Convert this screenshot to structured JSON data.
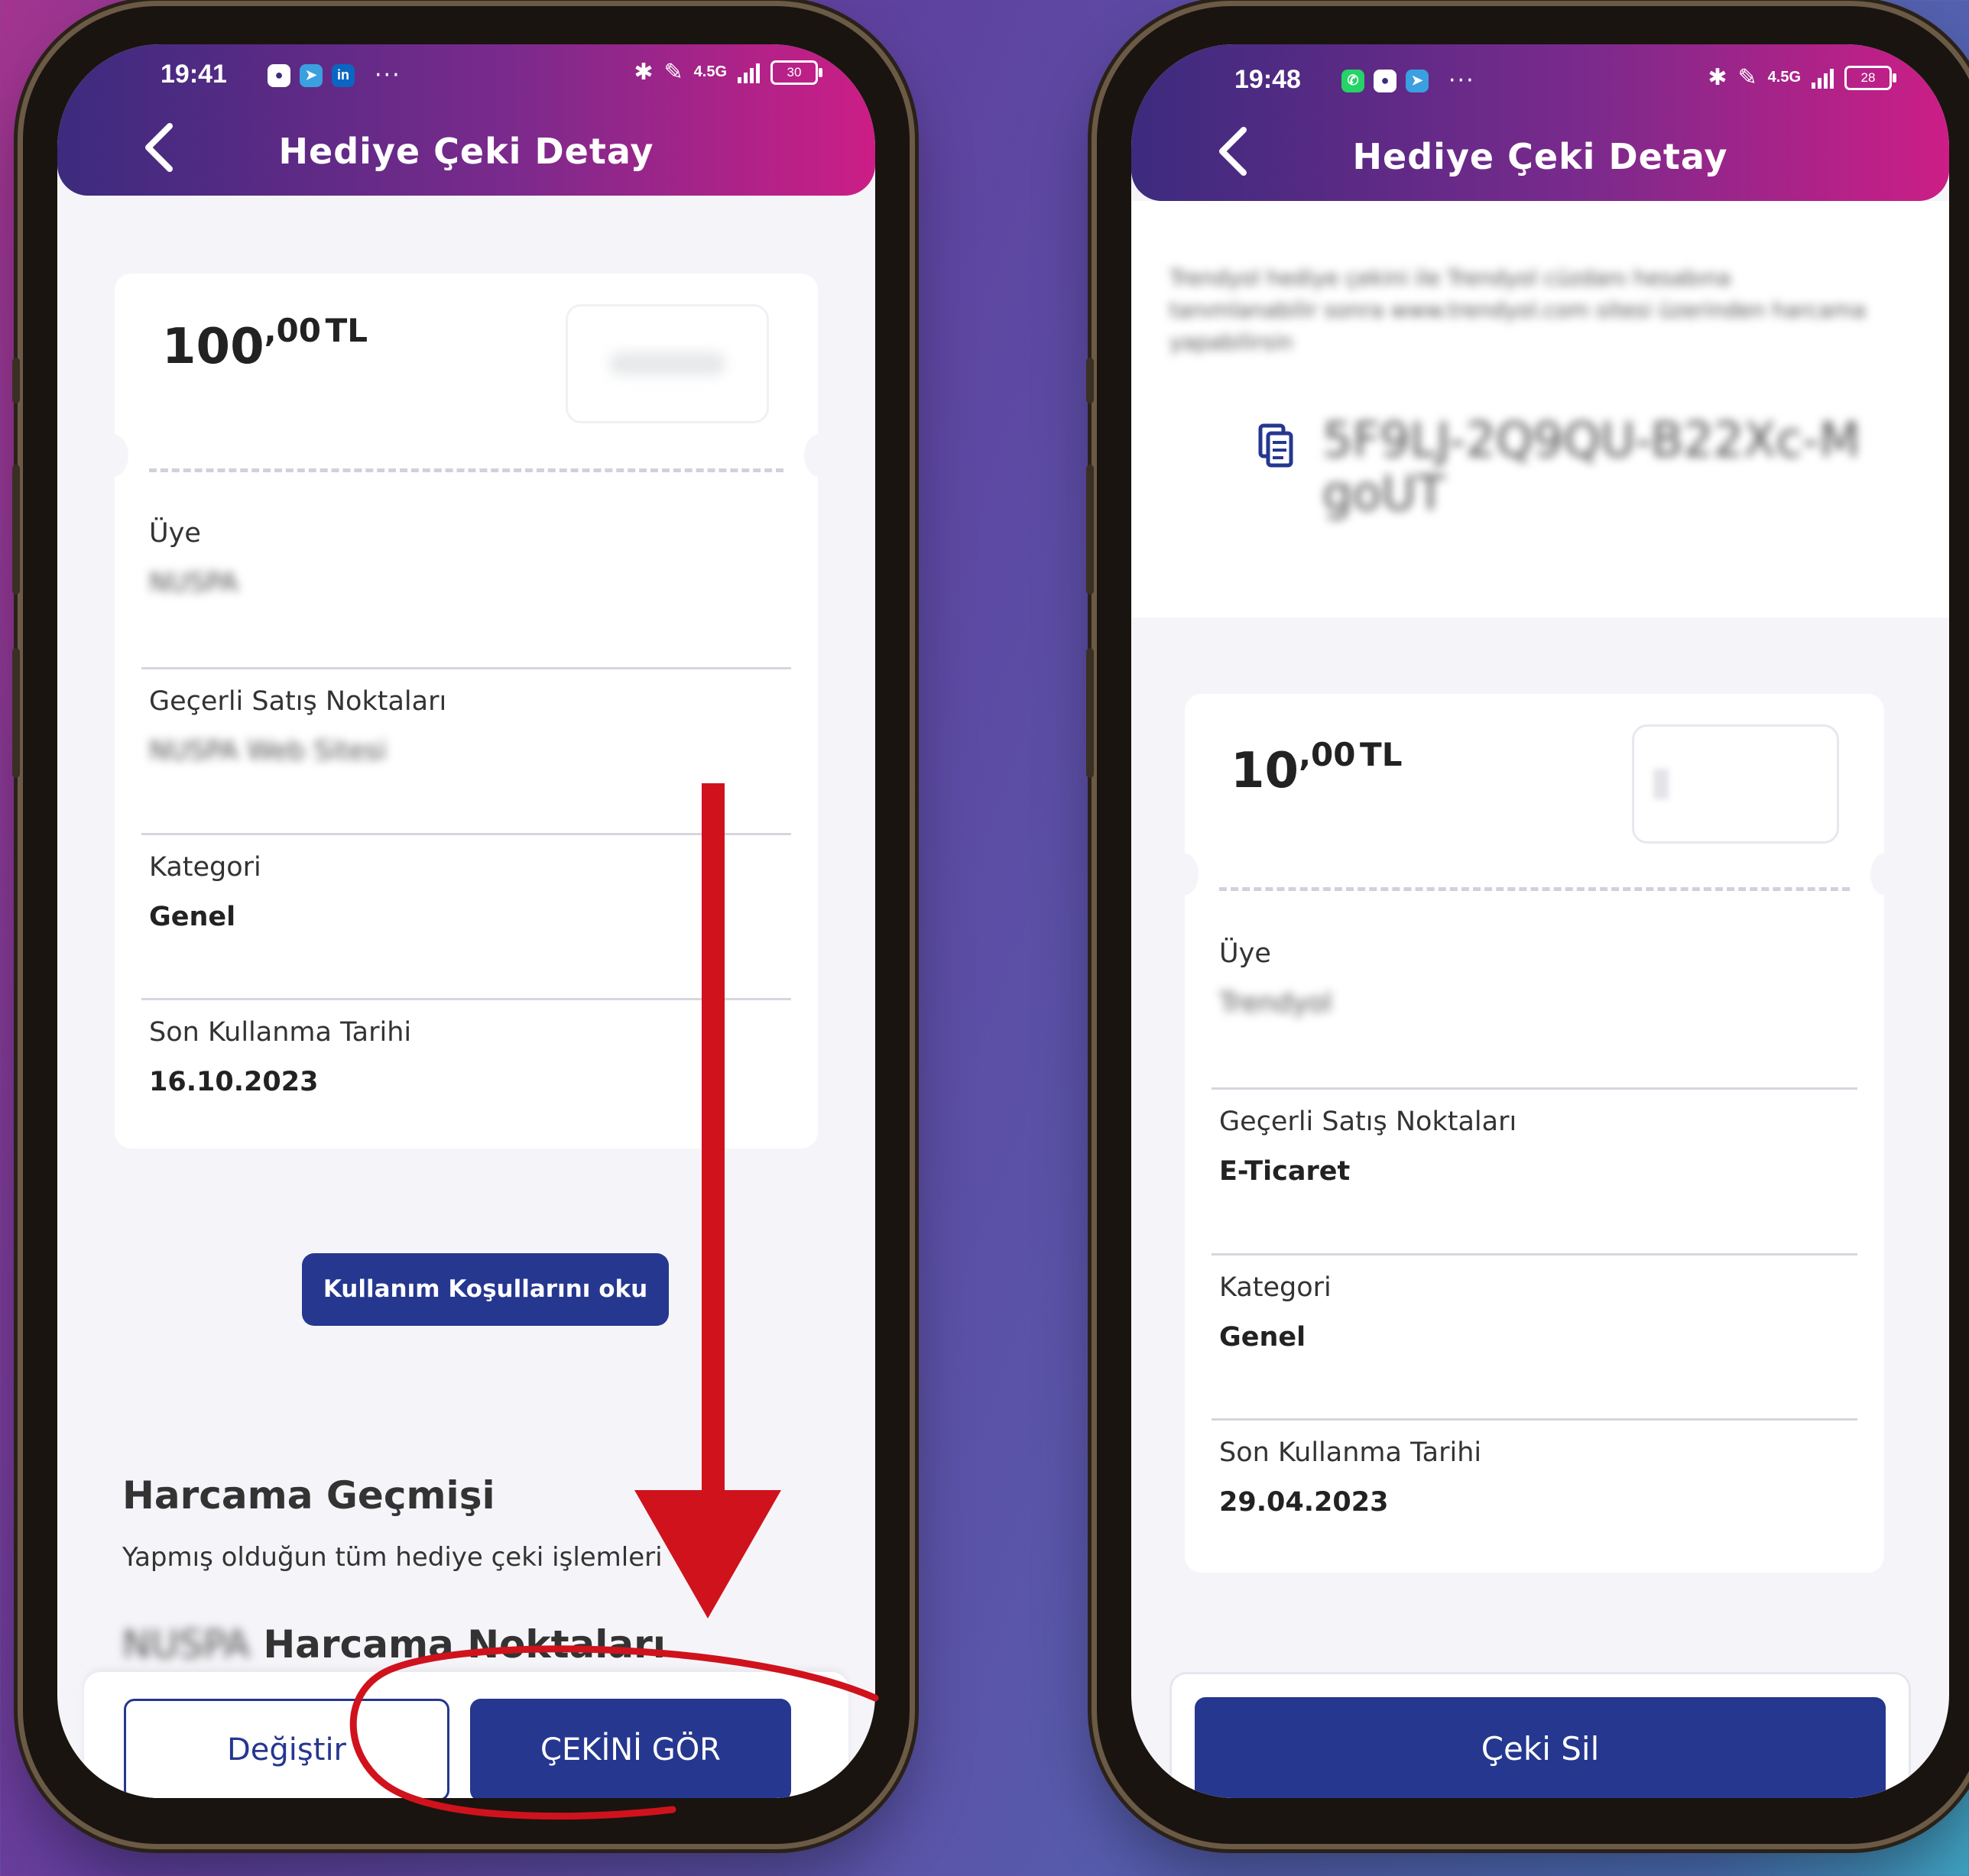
{
  "left_screen": {
    "status": {
      "time": "19:41",
      "battery": "30",
      "network": "4.5G"
    },
    "header": {
      "title": "Hediye Çeki Detay"
    },
    "card": {
      "amount_main": "100",
      "amount_decimals": ",00",
      "currency": "TL",
      "fields": [
        {
          "label": "Üye",
          "value": "NUSPA",
          "blurred": true
        },
        {
          "label": "Geçerli Satış Noktaları",
          "value": "NUSPA Web Sitesi",
          "blurred": true
        },
        {
          "label": "Kategori",
          "value": "Genel",
          "blurred": false
        },
        {
          "label": "Son Kullanma Tarihi",
          "value": "16.10.2023",
          "blurred": false
        }
      ]
    },
    "terms_button": "Kullanım Koşullarını oku",
    "history": {
      "title": "Harcama Geçmişi",
      "subtitle": "Yapmış olduğun tüm hediye çeki işlemleri",
      "arrow": "→"
    },
    "spending_points": {
      "brand": "NUSPA",
      "title": "Harcama Noktaları"
    },
    "footer": {
      "change_button": "Değiştir",
      "view_button": "ÇEKİNİ GÖR"
    },
    "annotation_color": "#d0121d"
  },
  "right_screen": {
    "status": {
      "time": "19:48",
      "battery": "28",
      "network": "4.5G"
    },
    "header": {
      "title": "Hediye Çeki Detay"
    },
    "info_text": "Trendyol hediye çekini ile Trendyol cüzdanı hesabına tanımlanabilir sonra www.trendyol.com sitesi üzerinden harcama yapabilirsin",
    "code_line1": "5F9LJ-2Q9QU-B22Xc-M",
    "code_line2": "goUT",
    "card": {
      "amount_main": "10",
      "amount_decimals": ",00",
      "currency": "TL",
      "fields": [
        {
          "label": "Üye",
          "value": "Trendyol",
          "blurred": true
        },
        {
          "label": "Geçerli Satış Noktaları",
          "value": "E-Ticaret",
          "blurred": false
        },
        {
          "label": "Kategori",
          "value": "Genel",
          "blurred": false
        },
        {
          "label": "Son Kullanma Tarihi",
          "value": "29.04.2023",
          "blurred": false
        }
      ]
    },
    "footer": {
      "delete_button": "Çeki Sil"
    }
  },
  "colors": {
    "brand_navy": "#25378f",
    "header_start": "#3c2b7e",
    "header_end": "#cc1e86",
    "annotation_red": "#d0121d"
  }
}
